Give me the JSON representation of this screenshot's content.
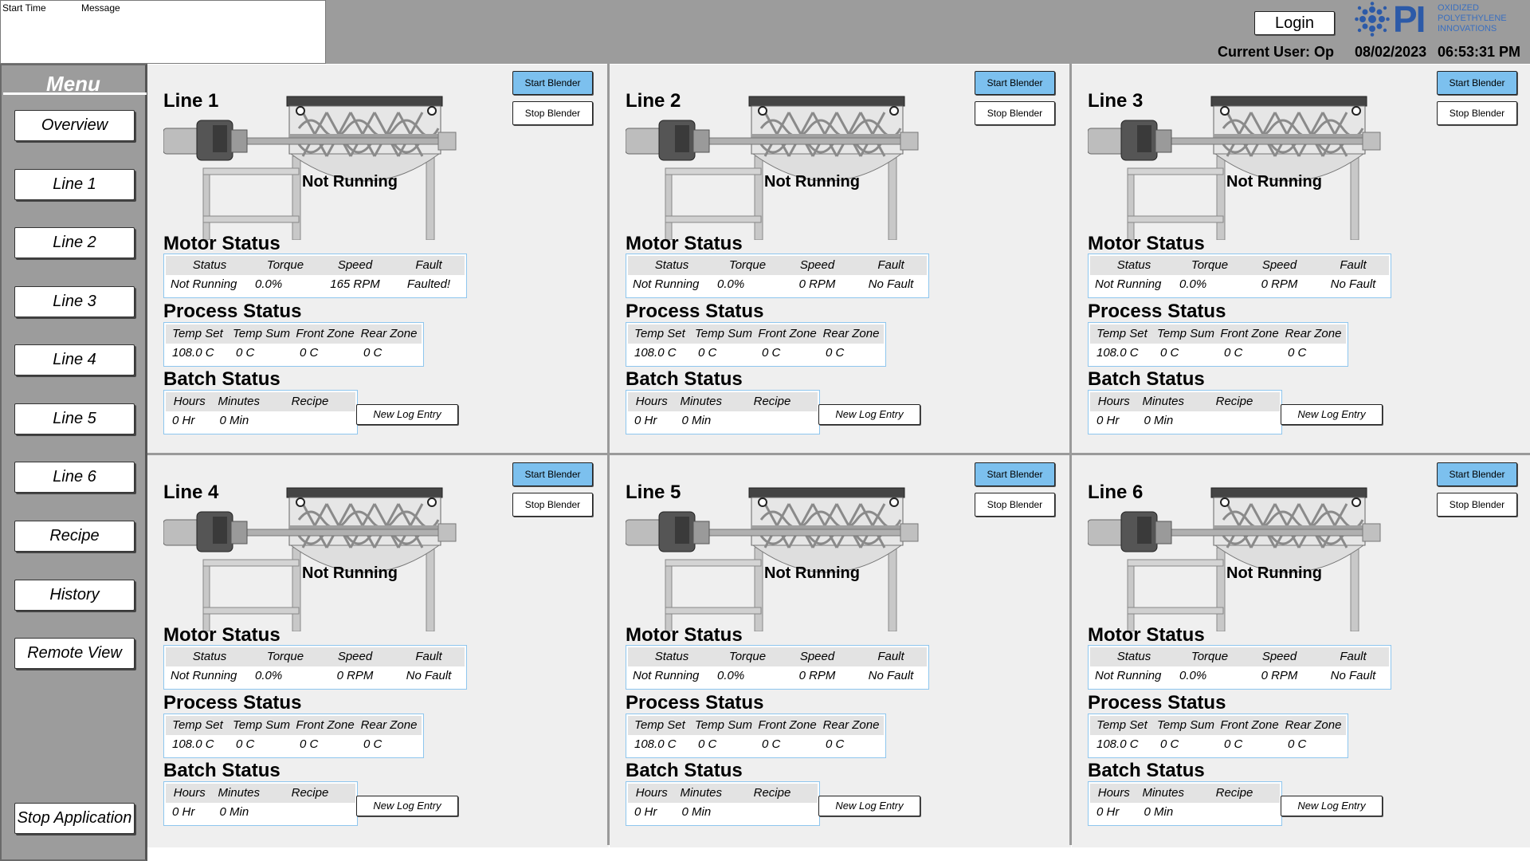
{
  "alarm_log": {
    "columns": [
      "Start Time",
      "Message"
    ]
  },
  "header": {
    "login_label": "Login",
    "current_user": "Current User: Op",
    "date": "08/02/2023",
    "time": "06:53:31 PM",
    "logo": {
      "mark": "PI",
      "lines": [
        "OXIDIZED",
        "POLYETHYLENE",
        "INNOVATIONS"
      ],
      "color": "#2c5aa8"
    }
  },
  "menu": {
    "title": "Menu",
    "items": [
      "Overview",
      "Line 1",
      "Line 2",
      "Line 3",
      "Line 4",
      "Line 5",
      "Line 6",
      "Recipe",
      "History",
      "Remote View"
    ],
    "stop_label": "Stop Application"
  },
  "labels": {
    "start_blender": "Start Blender",
    "stop_blender": "Stop Blender",
    "motor_status": "Motor Status",
    "process_status": "Process Status",
    "batch_status": "Batch Status",
    "new_log_entry": "New Log Entry",
    "motor_cols": [
      "Status",
      "Torque",
      "Speed",
      "Fault"
    ],
    "process_cols": [
      "Temp Set",
      "Temp Sum",
      "Front Zone",
      "Rear Zone"
    ],
    "batch_cols": [
      "Hours",
      "Minutes",
      "Recipe"
    ]
  },
  "colors": {
    "start_button": "#7cc0ee",
    "table_border": "#8ec6ee",
    "panel_bg": "#efefef",
    "chrome": "#9c9c9c"
  },
  "lines": [
    {
      "title": "Line 1",
      "run_state": "Not Running",
      "motor": {
        "status": "Not Running",
        "torque": "0.0%",
        "speed": "165 RPM",
        "fault": "Faulted!"
      },
      "process": {
        "temp_set": "108.0 C",
        "temp_sum": "0 C",
        "front_zone": "0 C",
        "rear_zone": "0 C"
      },
      "batch": {
        "hours": "0 Hr",
        "minutes": "0 Min",
        "recipe": ""
      }
    },
    {
      "title": "Line 2",
      "run_state": "Not Running",
      "motor": {
        "status": "Not Running",
        "torque": "0.0%",
        "speed": "0 RPM",
        "fault": "No Fault"
      },
      "process": {
        "temp_set": "108.0 C",
        "temp_sum": "0 C",
        "front_zone": "0 C",
        "rear_zone": "0 C"
      },
      "batch": {
        "hours": "0 Hr",
        "minutes": "0 Min",
        "recipe": ""
      }
    },
    {
      "title": "Line 3",
      "run_state": "Not Running",
      "motor": {
        "status": "Not Running",
        "torque": "0.0%",
        "speed": "0 RPM",
        "fault": "No Fault"
      },
      "process": {
        "temp_set": "108.0 C",
        "temp_sum": "0 C",
        "front_zone": "0 C",
        "rear_zone": "0 C"
      },
      "batch": {
        "hours": "0 Hr",
        "minutes": "0 Min",
        "recipe": ""
      }
    },
    {
      "title": "Line 4",
      "run_state": "Not Running",
      "motor": {
        "status": "Not Running",
        "torque": "0.0%",
        "speed": "0 RPM",
        "fault": "No Fault"
      },
      "process": {
        "temp_set": "108.0 C",
        "temp_sum": "0 C",
        "front_zone": "0 C",
        "rear_zone": "0 C"
      },
      "batch": {
        "hours": "0 Hr",
        "minutes": "0 Min",
        "recipe": ""
      }
    },
    {
      "title": "Line 5",
      "run_state": "Not Running",
      "motor": {
        "status": "Not Running",
        "torque": "0.0%",
        "speed": "0 RPM",
        "fault": "No Fault"
      },
      "process": {
        "temp_set": "108.0 C",
        "temp_sum": "0 C",
        "front_zone": "0 C",
        "rear_zone": "0 C"
      },
      "batch": {
        "hours": "0 Hr",
        "minutes": "0 Min",
        "recipe": ""
      }
    },
    {
      "title": "Line 6",
      "run_state": "Not Running",
      "motor": {
        "status": "Not Running",
        "torque": "0.0%",
        "speed": "0 RPM",
        "fault": "No Fault"
      },
      "process": {
        "temp_set": "108.0 C",
        "temp_sum": "0 C",
        "front_zone": "0 C",
        "rear_zone": "0 C"
      },
      "batch": {
        "hours": "0 Hr",
        "minutes": "0 Min",
        "recipe": ""
      }
    }
  ]
}
